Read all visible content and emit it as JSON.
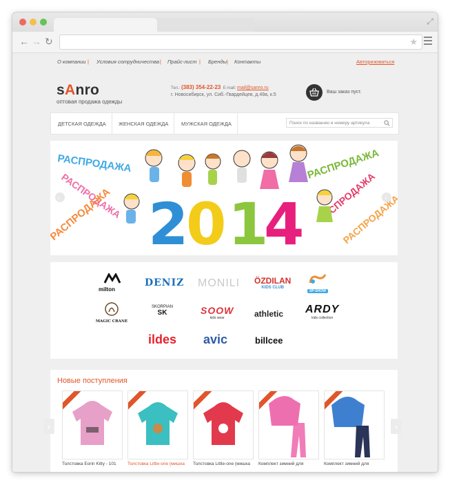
{
  "browser": {
    "address": "",
    "colors": {
      "close": "#ed6a5e",
      "minimize": "#f5bf4f",
      "maximize": "#62c554"
    }
  },
  "topnav": {
    "items": [
      "О компании",
      "Условия сотрудничества",
      "Прайс-лист",
      "Бренды",
      "Контакты"
    ],
    "auth": "Авторизоваться"
  },
  "header": {
    "logo_left": "s",
    "logo_accent": "A",
    "logo_right": "nro",
    "tagline": "оптовая продажа одежды",
    "tel_label": "Тел.:",
    "phone": "(383) 354-22-23",
    "email_label": "E-mail:",
    "email": "mail@sanro.ru",
    "address": "г. Новосибирск, ул. Сиб.-Гвардейцев, д.49а, к.5",
    "cart_text": "Ваш заказ пуст."
  },
  "catnav": {
    "items": [
      "ДЕТСКАЯ ОДЕЖДА",
      "ЖЕНСКАЯ ОДЕЖДА",
      "МУЖСКАЯ ОДЕЖДА"
    ],
    "search_placeholder": "Поиск по названию и номеру артикула"
  },
  "banner": {
    "sale_word": "РАСПРОДАЖА",
    "year_digits": [
      "2",
      "0",
      "1",
      "4"
    ],
    "year_colors": [
      "#2e8fd6",
      "#f3cc1a",
      "#8cc63f",
      "#e6207c"
    ]
  },
  "brands": {
    "milton": "milton",
    "deniz": "DENIZ",
    "monili": "MONILI",
    "ozdilan": "ÖZDILAN",
    "ozdilan_sub": "KIDS CLUB",
    "spshow": "SP-SHOW",
    "magic_crane": "MAGIC CRANE",
    "skorpian": "SKORPIAN",
    "skorpian_sub": "SK",
    "soow": "SOOW",
    "soow_sub": "kids wear",
    "athletic": "athletic",
    "ardy": "ARDY",
    "ardy_sub": "kids collection",
    "ildes": "ildes",
    "avic": "avic",
    "billcee": "billcee"
  },
  "new_arrivals": {
    "title": "Новые поступления",
    "products": [
      {
        "name": "Толстовка Eorin Kitty - 101",
        "color": "#e7a0c8"
      },
      {
        "name": "Толстовка Little-one (мишка",
        "color": "#3bbfc0"
      },
      {
        "name": "Толстовка Little-one (мишка",
        "color": "#e23a4c"
      },
      {
        "name": "Комплект зимний для",
        "color": "#ee6fb0"
      },
      {
        "name": "Комплект зимний для",
        "color": "#3f7fd0"
      }
    ]
  }
}
